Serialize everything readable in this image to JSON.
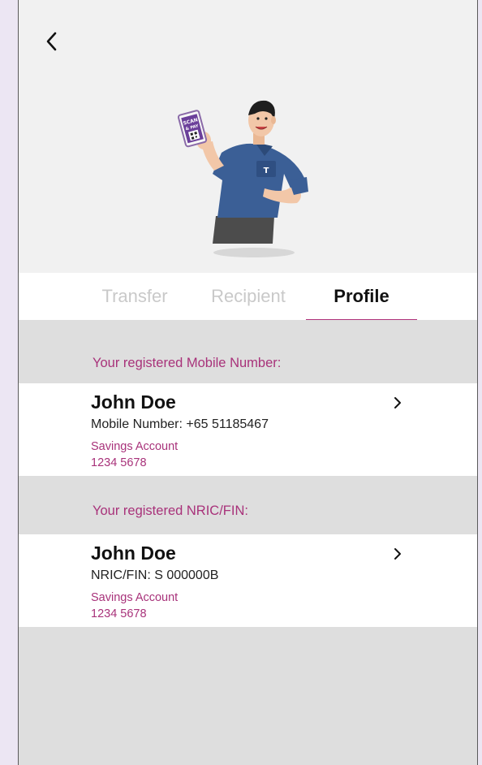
{
  "tabs": [
    {
      "label": "Transfer",
      "active": false
    },
    {
      "label": "Recipient",
      "active": false
    },
    {
      "label": "Profile",
      "active": true
    }
  ],
  "sections": [
    {
      "title": "Your registered Mobile Number:",
      "card": {
        "name": "John Doe",
        "detail": "Mobile Number: +65  51185467",
        "account_type": "Savings Account",
        "account_number": "1234 5678"
      }
    },
    {
      "title": "Your registered NRIC/FIN:",
      "card": {
        "name": "John Doe",
        "detail": "NRIC/FIN:  S 000000B",
        "account_type": "Savings Account",
        "account_number": "1234 5678"
      }
    }
  ],
  "phone_sign": {
    "line1": "SCAN",
    "line2": "& PAY"
  },
  "colors": {
    "accent": "#a8327a",
    "underline": "#b0327a",
    "shirt": "#3b5f96"
  },
  "icons": {
    "back": "chevron-left-icon",
    "row": "chevron-right-icon"
  }
}
